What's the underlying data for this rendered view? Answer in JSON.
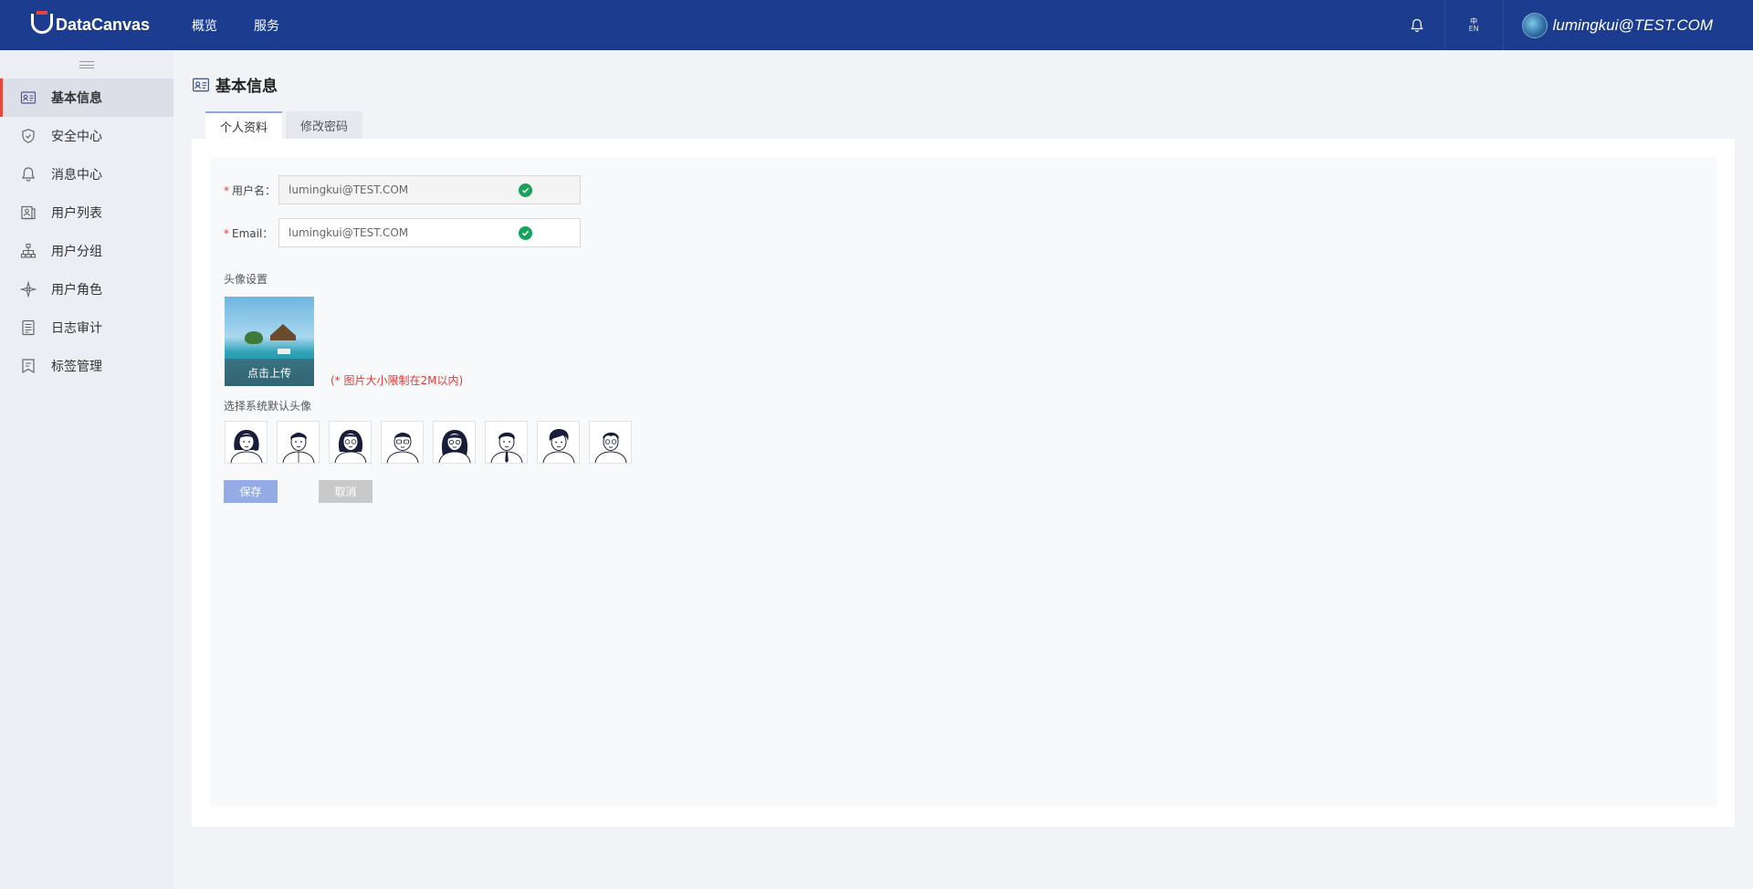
{
  "app": {
    "brand": "DataCanvas"
  },
  "topnav": {
    "items": [
      "概览",
      "服务"
    ]
  },
  "header": {
    "lang_zh": "中",
    "lang_en": "EN",
    "username": "lumingkui@TEST.COM"
  },
  "sidebar": {
    "items": [
      {
        "label": "基本信息",
        "icon": "profile-card-icon",
        "active": true
      },
      {
        "label": "安全中心",
        "icon": "shield-icon",
        "active": false
      },
      {
        "label": "消息中心",
        "icon": "bell-icon",
        "active": false
      },
      {
        "label": "用户列表",
        "icon": "user-list-icon",
        "active": false
      },
      {
        "label": "用户分组",
        "icon": "org-tree-icon",
        "active": false
      },
      {
        "label": "用户角色",
        "icon": "role-star-icon",
        "active": false
      },
      {
        "label": "日志审计",
        "icon": "log-list-icon",
        "active": false
      },
      {
        "label": "标签管理",
        "icon": "tag-icon",
        "active": false
      }
    ]
  },
  "page": {
    "title": "基本信息",
    "tabs": [
      "个人资料",
      "修改密码"
    ],
    "active_tab": "个人资料"
  },
  "form": {
    "username_label": "用户名：",
    "username_value": "lumingkui@TEST.COM",
    "email_label": "Email：",
    "email_value": "lumingkui@TEST.COM",
    "required_mark": "*",
    "avatar_section_label": "头像设置",
    "upload_label": "点击上传",
    "size_limit_note": "(* 图片大小限制在2M以内)",
    "default_avatar_label": "选择系统默认头像",
    "default_avatar_count": 8,
    "save_label": "保存",
    "cancel_label": "取消"
  },
  "colors": {
    "topbar": "#1c3d8f",
    "accent_red": "#e53935",
    "success_green": "#19a35a",
    "save_button": "#94abe6",
    "cancel_button": "#c9c9c9"
  }
}
